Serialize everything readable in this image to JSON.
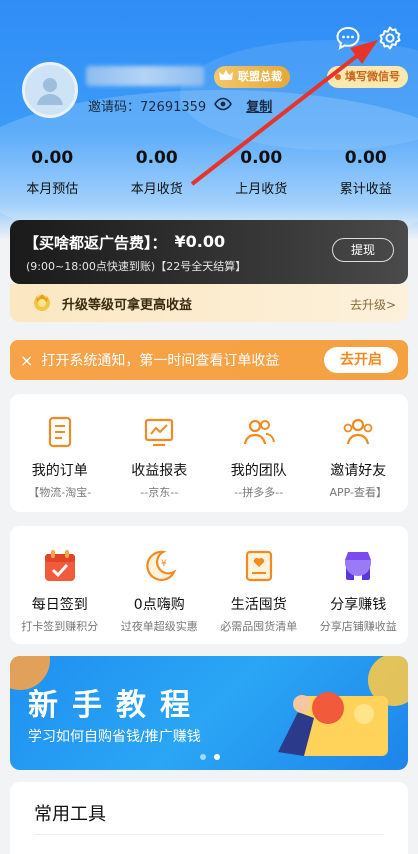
{
  "profile": {
    "level_badge": "联盟总裁",
    "fill_wechat": "填写微信号",
    "invite_label": "邀请码：",
    "invite_code": "72691359",
    "copy": "复制"
  },
  "stats": [
    {
      "value": "0.00",
      "label": "本月预估"
    },
    {
      "value": "0.00",
      "label": "本月收货"
    },
    {
      "value": "0.00",
      "label": "上月收货"
    },
    {
      "value": "0.00",
      "label": "累计收益"
    }
  ],
  "earnings": {
    "title": "【买啥都返广告费】：",
    "amount": "¥0.00",
    "sub": "(9:00~18:00点快速到账)【22号全天结算】",
    "withdraw": "提现"
  },
  "upgrade": {
    "text": "升级等级可拿更高收益",
    "action": "去升级>"
  },
  "notify": {
    "text": "打开系统通知，第一时间查看订单收益",
    "action": "去开启",
    "close": "×"
  },
  "menu1": [
    {
      "title": "我的订单",
      "sub": "【物流-淘宝-"
    },
    {
      "title": "收益报表",
      "sub": "--京东--"
    },
    {
      "title": "我的团队",
      "sub": "--拼多多--"
    },
    {
      "title": "邀请好友",
      "sub": "APP-查看】"
    }
  ],
  "menu2": [
    {
      "title": "每日签到",
      "sub": "打卡签到赚积分"
    },
    {
      "title": "0点嗨购",
      "sub": "过夜单超级实惠"
    },
    {
      "title": "生活囤货",
      "sub": "必需品囤货清单"
    },
    {
      "title": "分享赚钱",
      "sub": "分享店铺赚收益"
    }
  ],
  "banner": {
    "big": "新手教程",
    "small": "学习如何自购省钱/推广赚钱"
  },
  "tools": {
    "title": "常用工具"
  },
  "colors": {
    "primary": "#2f8df5",
    "accent": "#f08a22",
    "icon": "#f08a22"
  }
}
